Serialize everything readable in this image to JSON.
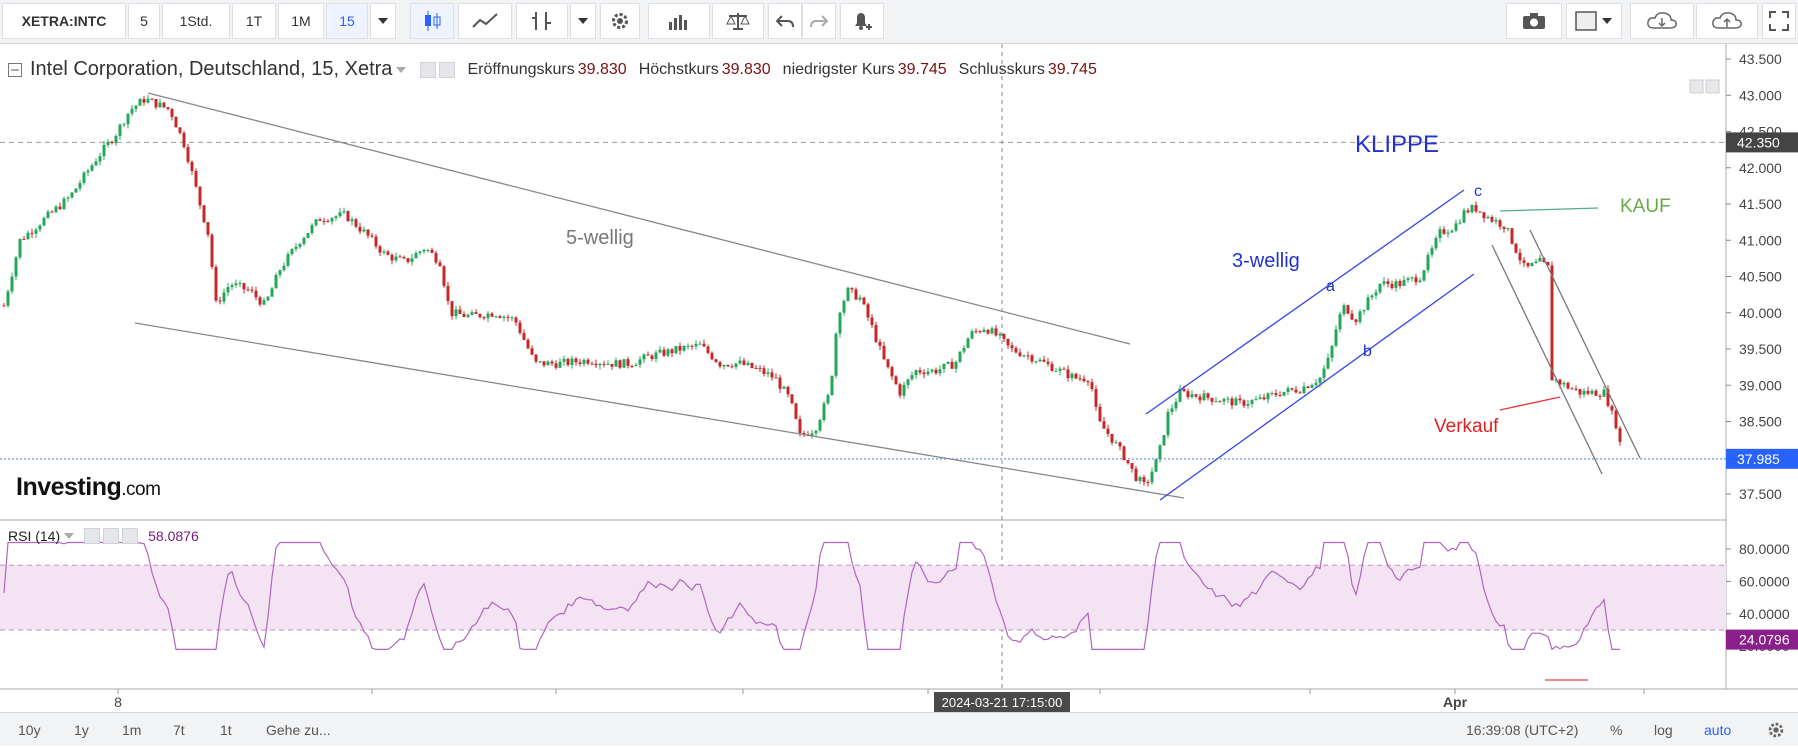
{
  "toolbar": {
    "symbol": "XETRA:INTC",
    "intervals": [
      "5",
      "1Std.",
      "1T",
      "1M",
      "15"
    ],
    "active_interval": "15"
  },
  "legend": {
    "title": "Intel Corporation, Deutschland, 15, Xetra",
    "open_label": "Eröffnungskurs",
    "open_value": "39.830",
    "high_label": "Höchstkurs",
    "high_value": "39.830",
    "low_label": "niedrigster Kurs",
    "low_value": "39.745",
    "close_label": "Schlusskurs",
    "close_value": "39.745"
  },
  "price_axis": {
    "ticks": [
      "43.500",
      "43.000",
      "42.500",
      "42.000",
      "41.500",
      "41.000",
      "40.500",
      "40.000",
      "39.500",
      "39.000",
      "38.500",
      "38.000",
      "37.500"
    ],
    "marker_high": "42.350",
    "marker_last": "37.985"
  },
  "annotations": {
    "five_wave": "5-wellig",
    "three_wave": "3-wellig",
    "klippe": "KLIPPE",
    "kauf": "KAUF",
    "verkauf": "Verkauf",
    "wave_a": "a",
    "wave_b": "b",
    "wave_c": "c"
  },
  "rsi": {
    "label": "RSI (14)",
    "value": "58.0876",
    "ticks": [
      "80.0000",
      "60.0000",
      "40.0000",
      "20.0000"
    ],
    "marker": "24.0796"
  },
  "time_axis": {
    "labels": [
      "8",
      "Apr"
    ],
    "crosshair_date": "2024-03-21 17:15:00"
  },
  "logo": {
    "main": "Investing",
    "suffix": ".com"
  },
  "bottombar": {
    "ranges": [
      "10y",
      "1y",
      "1m",
      "7t",
      "1t"
    ],
    "goto": "Gehe zu...",
    "clock": "16:39:08 (UTC+2)",
    "percent": "%",
    "log": "log",
    "auto": "auto"
  },
  "colors": {
    "up": "#26a65b",
    "down": "#c62828",
    "channel": "#3344ee",
    "trend": "#888888",
    "rsi_line": "#b066c0",
    "rsi_band": "#f3e3f3"
  }
}
